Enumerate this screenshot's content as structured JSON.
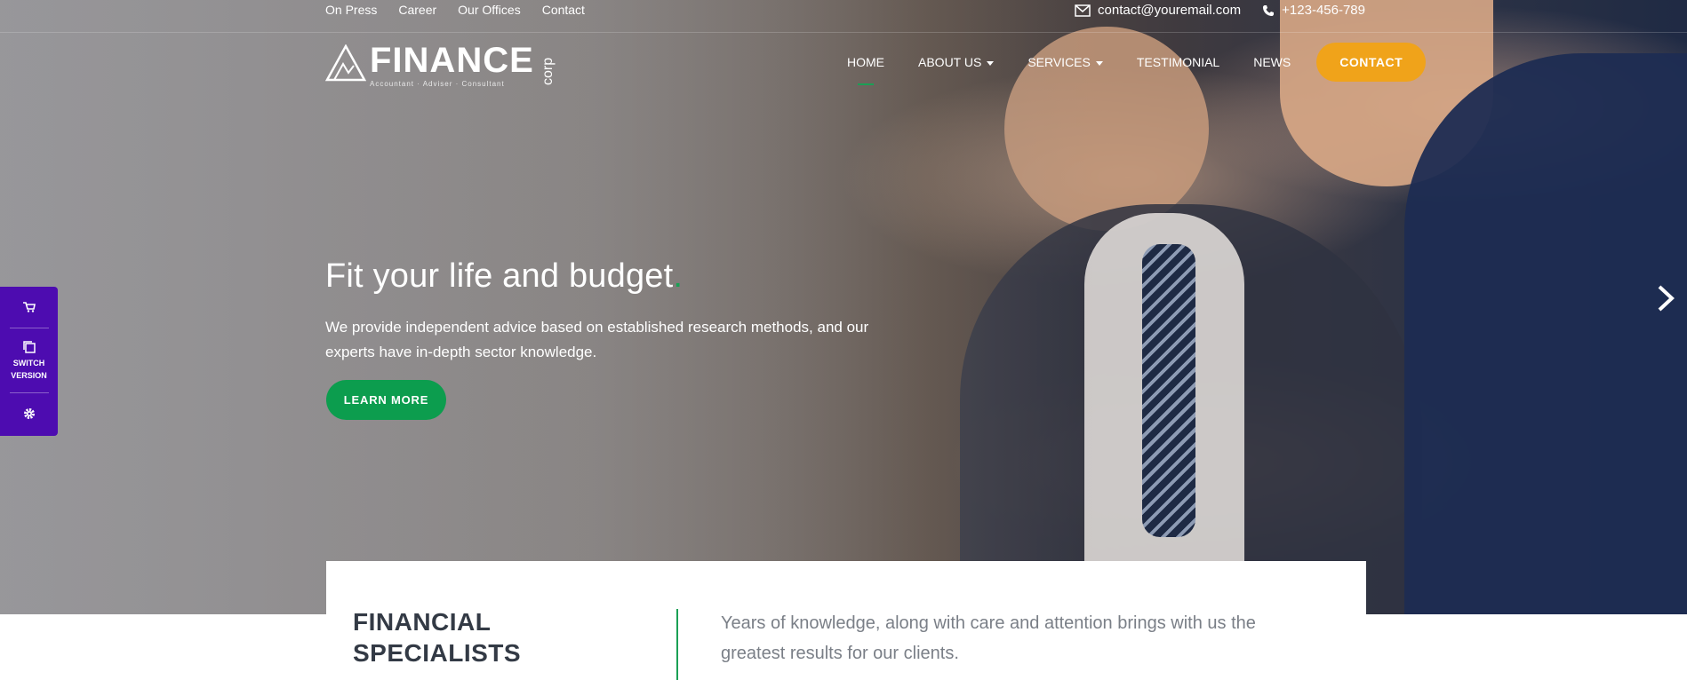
{
  "topbar": {
    "links": [
      "On Press",
      "Career",
      "Our Offices",
      "Contact"
    ],
    "email": "contact@youremail.com",
    "phone": "+123-456-789",
    "email_icon": "envelope-icon",
    "phone_icon": "phone-icon"
  },
  "logo": {
    "word": "FINANCE",
    "tagline": "Accountant · Adviser · Consultant",
    "suffix": "corp"
  },
  "nav": {
    "home": "HOME",
    "about": "ABOUT US",
    "services": "SERVICES",
    "testimonial": "TESTIMONIAL",
    "news": "NEWS",
    "contact": "CONTACT"
  },
  "hero": {
    "headline": "Fit your life and budget",
    "headline_dot": ".",
    "subtext": "We provide independent advice based on established research methods, and our experts have in-depth sector knowledge.",
    "button": "LEARN MORE"
  },
  "side_panel": {
    "switch_label_1": "SWITCH",
    "switch_label_2": "VERSION",
    "icons": [
      "cart-icon",
      "copy-icon",
      "gear-icon"
    ]
  },
  "card": {
    "title_line1": "FINANCIAL",
    "title_line2": "SPECIALISTS",
    "description": "Years of knowledge, along with care and attention brings with us the greatest results for our clients."
  },
  "colors": {
    "accent_green": "#1aa055",
    "button_green": "#0c9d4e",
    "contact_orange": "#f0a31a",
    "side_panel_purple": "#4d0cb0"
  }
}
